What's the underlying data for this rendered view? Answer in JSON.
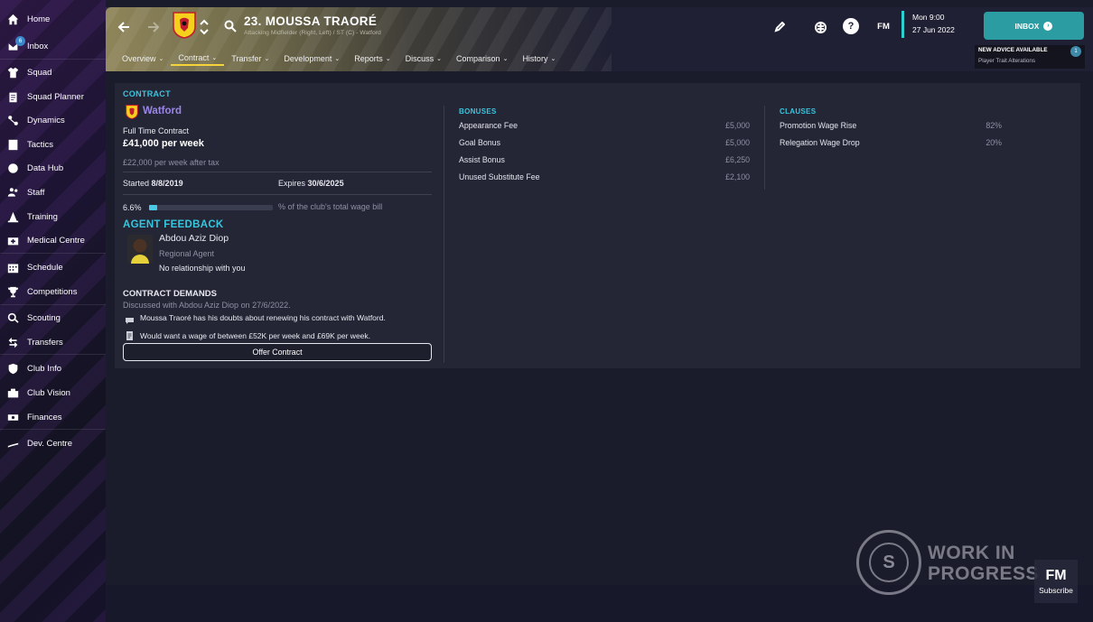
{
  "sidebar": {
    "items": [
      {
        "label": "Home",
        "icon": "home-icon"
      },
      {
        "label": "Inbox",
        "icon": "inbox-icon",
        "badge": "6"
      },
      {
        "label": "Squad",
        "icon": "shirt-icon"
      },
      {
        "label": "Squad Planner",
        "icon": "clipboard-icon"
      },
      {
        "label": "Dynamics",
        "icon": "dynamics-icon"
      },
      {
        "label": "Tactics",
        "icon": "tactics-board-icon"
      },
      {
        "label": "Data Hub",
        "icon": "data-hub-icon"
      },
      {
        "label": "Staff",
        "icon": "staff-icon"
      },
      {
        "label": "Training",
        "icon": "cone-icon"
      },
      {
        "label": "Medical Centre",
        "icon": "medical-kit-icon"
      },
      {
        "label": "Schedule",
        "icon": "calendar-icon"
      },
      {
        "label": "Competitions",
        "icon": "trophy-icon"
      },
      {
        "label": "Scouting",
        "icon": "magnifier-icon"
      },
      {
        "label": "Transfers",
        "icon": "transfer-arrows-icon"
      },
      {
        "label": "Club Info",
        "icon": "shield-icon"
      },
      {
        "label": "Club Vision",
        "icon": "club-vision-icon"
      },
      {
        "label": "Finances",
        "icon": "banknote-icon"
      },
      {
        "label": "Dev. Centre",
        "icon": "dev-centre-icon"
      }
    ]
  },
  "header": {
    "player_name": "23. MOUSSA TRAORÉ",
    "player_sub": "Attacking Midfielder (Right, Left) / ST (C) - Watford",
    "tabs": [
      {
        "label": "Overview"
      },
      {
        "label": "Contract"
      },
      {
        "label": "Transfer"
      },
      {
        "label": "Development"
      },
      {
        "label": "Reports"
      },
      {
        "label": "Discuss"
      },
      {
        "label": "Comparison"
      },
      {
        "label": "History"
      }
    ],
    "active_tab": "Contract",
    "fm_label": "FM",
    "date_line1": "Mon 9:00",
    "date_line2": "27 Jun 2022",
    "inbox_label": "INBOX",
    "advice_title": "NEW ADVICE AVAILABLE",
    "advice_text": "Player Trait Alterations",
    "advice_badge": "1",
    "accent_color": "#2a9ca2"
  },
  "contract": {
    "title": "CONTRACT",
    "club": "Watford",
    "contract_type": "Full Time Contract",
    "wage": "£41,000 per week",
    "after_tax": "£22,000 per week after tax",
    "started_label": "Started",
    "started_value": "8/8/2019",
    "expires_label": "Expires",
    "expires_value": "30/6/2025",
    "wage_share_pct": "6.6%",
    "wage_share_value": 6.6,
    "wage_share_text": "% of the club's total wage bill"
  },
  "agent": {
    "title": "AGENT FEEDBACK",
    "name": "Abdou Aziz Diop",
    "role": "Regional Agent",
    "relationship": "No relationship with you"
  },
  "demands": {
    "title": "CONTRACT DEMANDS",
    "discussed": "Discussed with Abdou Aziz Diop on 27/6/2022.",
    "line1": "Moussa Traoré has his doubts about renewing his contract with Watford.",
    "line2": "Would want a wage of between £52K per week and £69K per week.",
    "offer_button": "Offer Contract"
  },
  "bonuses": {
    "title": "BONUSES",
    "rows": [
      {
        "label": "Appearance Fee",
        "value": "£5,000"
      },
      {
        "label": "Goal Bonus",
        "value": "£5,000"
      },
      {
        "label": "Assist Bonus",
        "value": "£6,250"
      },
      {
        "label": "Unused Substitute Fee",
        "value": "£2,100"
      }
    ]
  },
  "clauses": {
    "title": "CLAUSES",
    "rows": [
      {
        "label": "Promotion Wage Rise",
        "value": "82%"
      },
      {
        "label": "Relegation Wage Drop",
        "value": "20%"
      }
    ]
  },
  "watermark": {
    "line1": "WORK IN",
    "line2": "PROGRESS",
    "fm": "FM",
    "subscribe": "Subscribe",
    "logo_letter": "S"
  }
}
